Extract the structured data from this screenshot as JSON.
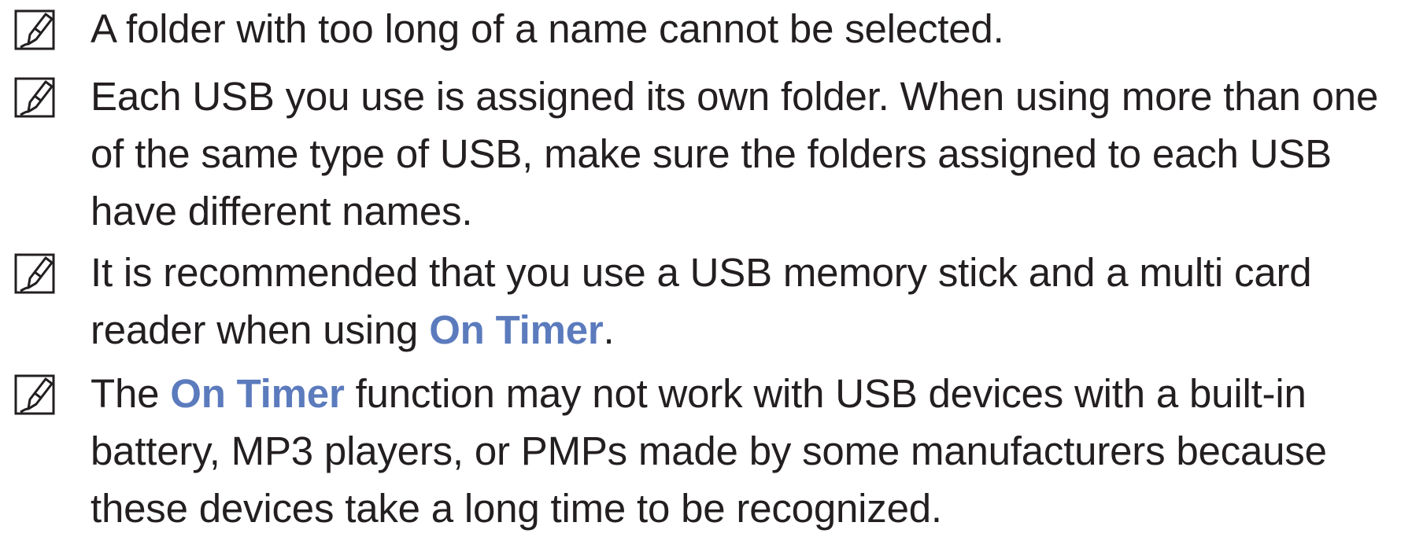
{
  "icon_name": "note-pencil-icon",
  "highlight_color": "#5b7bbd",
  "notes": [
    {
      "lines": [
        "A folder with too long of a name cannot be selected."
      ]
    },
    {
      "lines": [
        "Each USB you use is assigned its own folder. When using more than one",
        "of the same type of USB, make sure the folders assigned to each USB",
        "have different names."
      ]
    },
    {
      "line1": "It is recommended that you use a USB memory stick and a multi card",
      "line2_before": "reader when using ",
      "line2_highlight": "On Timer",
      "line2_after": "."
    },
    {
      "line1_before": "The ",
      "line1_highlight": "On Timer",
      "line1_after": " function may not work with USB devices with a built-in",
      "line2": "battery, MP3 players, or PMPs made by some manufacturers because",
      "line3": "these devices take a long time to be recognized."
    }
  ]
}
